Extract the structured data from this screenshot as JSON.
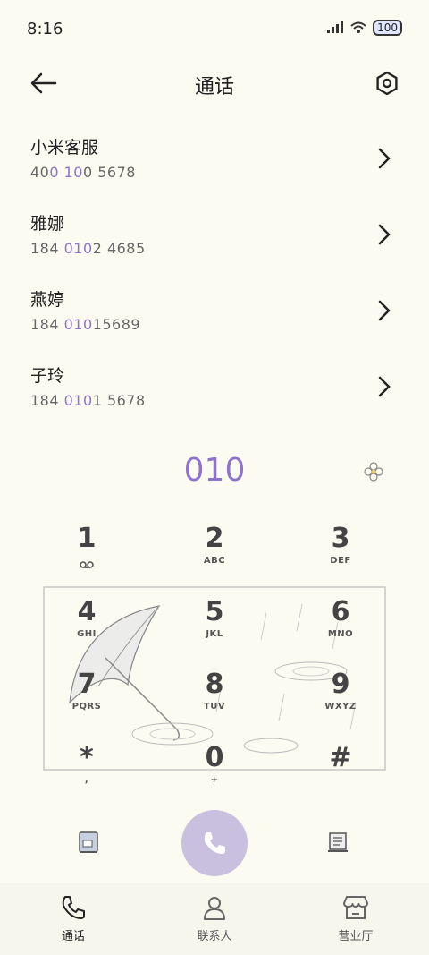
{
  "status": {
    "time": "8:16",
    "battery": "100",
    "signal_icon": "signal-icon",
    "wifi_icon": "wifi-icon"
  },
  "header": {
    "title": "通话"
  },
  "contacts": [
    {
      "name": "小米客服",
      "num_pre": "40",
      "num_hl": "0 10",
      "num_post": "0 5678"
    },
    {
      "name": "雅娜",
      "num_pre": "184 ",
      "num_hl": "010",
      "num_post": "2 4685"
    },
    {
      "name": "燕婷",
      "num_pre": "184 ",
      "num_hl": "010",
      "num_post": "15689"
    },
    {
      "name": "子玲",
      "num_pre": "184 ",
      "num_hl": "010",
      "num_post": "1 5678"
    }
  ],
  "dial": {
    "input": "010"
  },
  "keypad": [
    {
      "digit": "1",
      "letters": ""
    },
    {
      "digit": "2",
      "letters": "ABC"
    },
    {
      "digit": "3",
      "letters": "DEF"
    },
    {
      "digit": "4",
      "letters": "GHI"
    },
    {
      "digit": "5",
      "letters": "JKL"
    },
    {
      "digit": "6",
      "letters": "MNO"
    },
    {
      "digit": "7",
      "letters": "PQRS"
    },
    {
      "digit": "8",
      "letters": "TUV"
    },
    {
      "digit": "9",
      "letters": "WXYZ"
    },
    {
      "digit": "*",
      "letters": ","
    },
    {
      "digit": "0",
      "letters": "+"
    },
    {
      "digit": "#",
      "letters": ""
    }
  ],
  "tabs": [
    {
      "label": "通话"
    },
    {
      "label": "联系人"
    },
    {
      "label": "营业厅"
    }
  ],
  "colors": {
    "accent": "#8d73cc",
    "background": "#fcfbf2",
    "call_button": "#c9bfdf"
  }
}
